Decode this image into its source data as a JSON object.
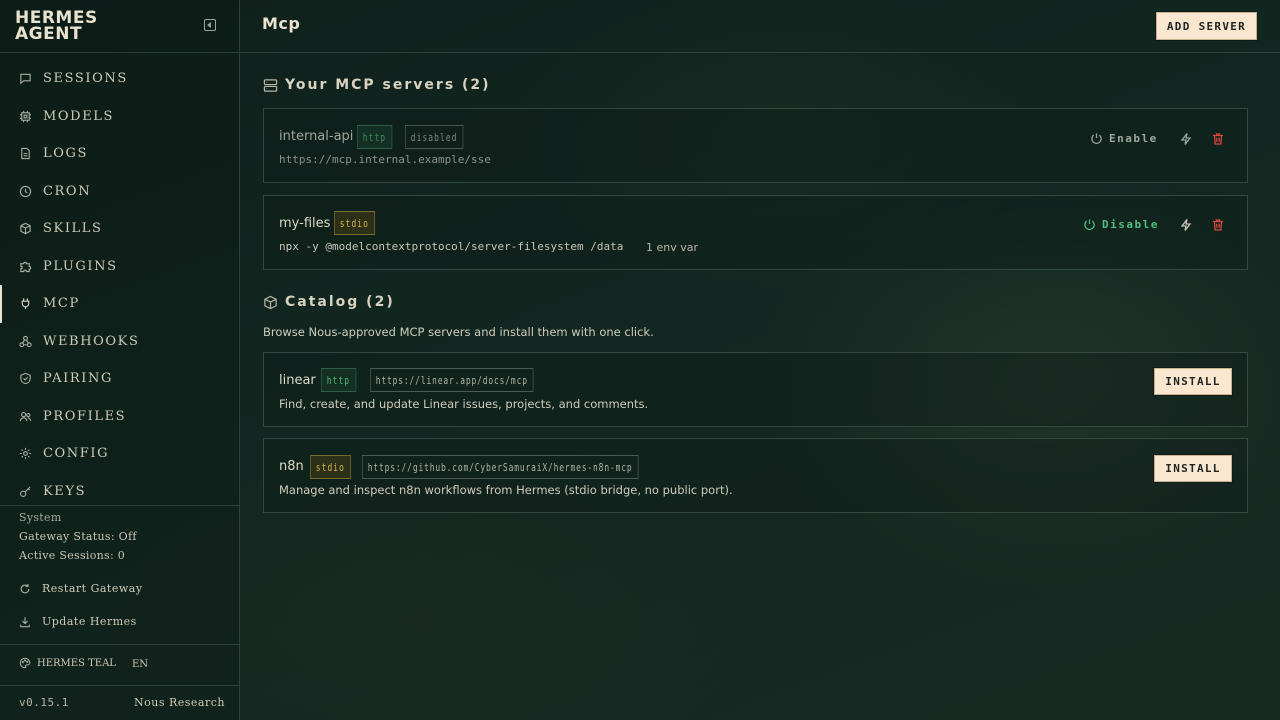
{
  "app": {
    "brand_line1": "HERMES",
    "brand_line2": "AGENT"
  },
  "sidebar": {
    "items": [
      {
        "label": "SESSIONS",
        "icon": "chat-bubble-icon"
      },
      {
        "label": "MODELS",
        "icon": "cpu-chip-icon"
      },
      {
        "label": "LOGS",
        "icon": "document-icon"
      },
      {
        "label": "CRON",
        "icon": "clock-icon"
      },
      {
        "label": "SKILLS",
        "icon": "package-icon"
      },
      {
        "label": "PLUGINS",
        "icon": "puzzle-icon"
      },
      {
        "label": "MCP",
        "icon": "plug-icon",
        "active": true
      },
      {
        "label": "WEBHOOKS",
        "icon": "webhook-icon"
      },
      {
        "label": "PAIRING",
        "icon": "shield-check-icon"
      },
      {
        "label": "PROFILES",
        "icon": "users-icon"
      },
      {
        "label": "CONFIG",
        "icon": "gear-icon"
      },
      {
        "label": "KEYS",
        "icon": "key-icon"
      }
    ],
    "system": {
      "label": "System",
      "gateway_status": "Gateway Status: Off",
      "active_sessions": "Active Sessions: 0",
      "restart_label": "Restart Gateway",
      "update_label": "Update Hermes"
    },
    "theme": "HERMES TEAL",
    "language": "EN",
    "version": "v0.15.1",
    "org": "Nous Research"
  },
  "header": {
    "title": "Mcp",
    "add_button": "ADD SERVER"
  },
  "servers": {
    "title": "Your MCP servers (2)",
    "items": [
      {
        "name": "internal-api",
        "transport": "http",
        "status": "disabled",
        "command": "https://mcp.internal.example/sse",
        "toggle_label": "Enable"
      },
      {
        "name": "my-files",
        "transport": "stdio",
        "command": "npx -y @modelcontextprotocol/server-filesystem /data",
        "env": "1 env var",
        "toggle_label": "Disable"
      }
    ]
  },
  "catalog": {
    "title": "Catalog (2)",
    "intro": "Browse Nous-approved MCP servers and install them with one click.",
    "items": [
      {
        "name": "linear",
        "transport": "http",
        "url": "https://linear.app/docs/mcp",
        "description": "Find, create, and update Linear issues, projects, and comments.",
        "install_label": "INSTALL"
      },
      {
        "name": "n8n",
        "transport": "stdio",
        "url": "https://github.com/CyberSamuraiX/hermes-n8n-mcp",
        "description": "Manage and inspect n8n workflows from Hermes (stdio bridge, no public port).",
        "install_label": "INSTALL"
      }
    ]
  },
  "colors": {
    "accent_cream": "#fbe7cf",
    "http_green": "#52b47c",
    "stdio_gold": "#d8b250",
    "danger_red": "#d9473e",
    "enabled_green": "#4fc07e"
  }
}
